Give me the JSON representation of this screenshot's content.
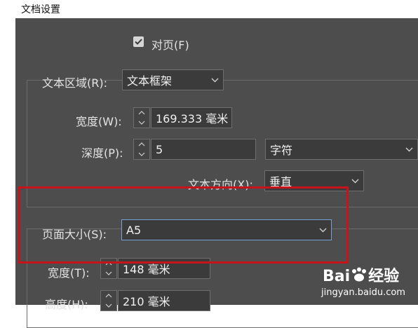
{
  "window": {
    "title": "文档设置"
  },
  "facing_pages": {
    "label": "对页(F)",
    "checked": true
  },
  "text_area": {
    "label": "文本区域(R):",
    "value": "文本框架"
  },
  "width_w": {
    "label": "宽度(W):",
    "value": "169.333 毫米"
  },
  "depth": {
    "label": "深度(P):",
    "value": "5",
    "unit": "字符"
  },
  "text_direction": {
    "label": "文本方向(X):",
    "value": "垂直"
  },
  "page_size": {
    "label": "页面大小(S):",
    "value": "A5"
  },
  "width_t": {
    "label": "宽度(T):",
    "value": "148 毫米"
  },
  "height_h": {
    "label": "高度(H):",
    "value": "210 毫米"
  },
  "watermark": {
    "brand_a": "Bai",
    "brand_b": "经验",
    "url": "jingyan.baidu.com"
  },
  "colors": {
    "dialog_bg": "#4d4d4d",
    "field_bg": "#3b3b3b",
    "highlight": "#c8131b",
    "focus_border": "#7aa0d6"
  }
}
